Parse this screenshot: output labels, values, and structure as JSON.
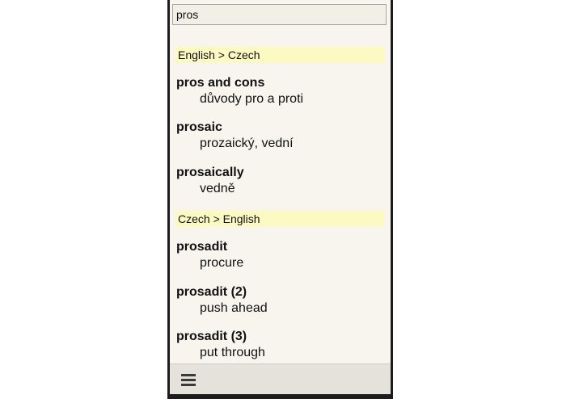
{
  "search": {
    "value": "pros",
    "placeholder": ""
  },
  "sections": [
    {
      "header": "English > Czech",
      "entries": [
        {
          "term": "pros and cons",
          "translation": "důvody pro a proti"
        },
        {
          "term": "prosaic",
          "translation": "prozaický, vední"
        },
        {
          "term": "prosaically",
          "translation": "vedně"
        }
      ]
    },
    {
      "header": "Czech > English",
      "entries": [
        {
          "term": "prosadit",
          "translation": "procure"
        },
        {
          "term": "prosadit (2)",
          "translation": "push ahead"
        },
        {
          "term": "prosadit (3)",
          "translation": "put through"
        }
      ]
    }
  ],
  "toolbar": {
    "menu_icon": "hamburger-menu-icon"
  },
  "colors": {
    "background": "#f7f5ed",
    "section_header": "#fdf9c3",
    "bottom_bar": "#e4e2db",
    "frame": "#1c1c1c"
  }
}
